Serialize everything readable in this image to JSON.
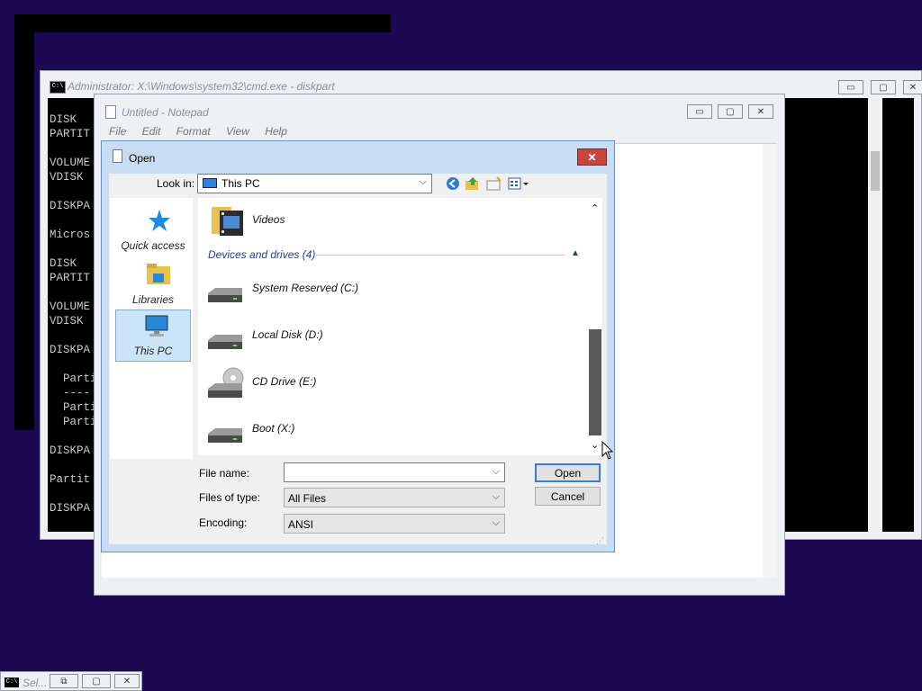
{
  "cmd": {
    "title": "Administrator: X:\\Windows\\system32\\cmd.exe - diskpart",
    "icon_text": "C:\\",
    "lines": "DISK\nPARTIT\n\nVOLUME\nVDISK\n\nDISKPA\n\nMicros\n\nDISK\nPARTIT\n\nVOLUME\nVDISK\n\nDISKPA\n\n  Parti\n  ----\n  Parti\n  Parti\n\nDISKPA\n\nPartit\n\nDISKPA",
    "buttons": {
      "minimize": "▭",
      "maximize": "▢",
      "close": "✕"
    }
  },
  "notepad": {
    "title": "Untitled - Notepad",
    "menu": [
      "File",
      "Edit",
      "Format",
      "View",
      "Help"
    ],
    "buttons": {
      "minimize": "▭",
      "maximize": "▢",
      "close": "✕"
    }
  },
  "dialog": {
    "title": "Open",
    "close": "✕",
    "look_in_label": "Look in:",
    "look_in_value": "This PC",
    "toolbar_icons": [
      "back-icon",
      "up-folder-icon",
      "new-folder-icon",
      "view-menu-icon"
    ],
    "places": [
      {
        "label": "Quick access",
        "icon": "star-icon"
      },
      {
        "label": "Libraries",
        "icon": "libraries-icon"
      },
      {
        "label": "This PC",
        "icon": "computer-icon"
      }
    ],
    "folder_item": "Videos",
    "group_header": "Devices and drives (4)",
    "drives": [
      {
        "label": "System Reserved (C:)",
        "icon": "hard-drive-icon"
      },
      {
        "label": "Local Disk (D:)",
        "icon": "hard-drive-icon"
      },
      {
        "label": "CD Drive (E:)",
        "icon": "cd-drive-icon"
      },
      {
        "label": "Boot (X:)",
        "icon": "hard-drive-icon"
      }
    ],
    "file_name_label": "File name:",
    "file_name_value": "",
    "file_type_label": "Files of type:",
    "file_type_value": "All Files",
    "encoding_label": "Encoding:",
    "encoding_value": "ANSI",
    "open_button": "Open",
    "cancel_button": "Cancel"
  },
  "taskbar_window": {
    "title": "Sel...",
    "icon_text": "C:\\",
    "buttons": {
      "restore": "⧉",
      "maximize": "▢",
      "close": "✕"
    }
  },
  "colors": {
    "desktop": "#1b0a52",
    "dialog_frame": "#c8dcf2",
    "close_red": "#c8453a",
    "selection": "#cce4f7"
  }
}
